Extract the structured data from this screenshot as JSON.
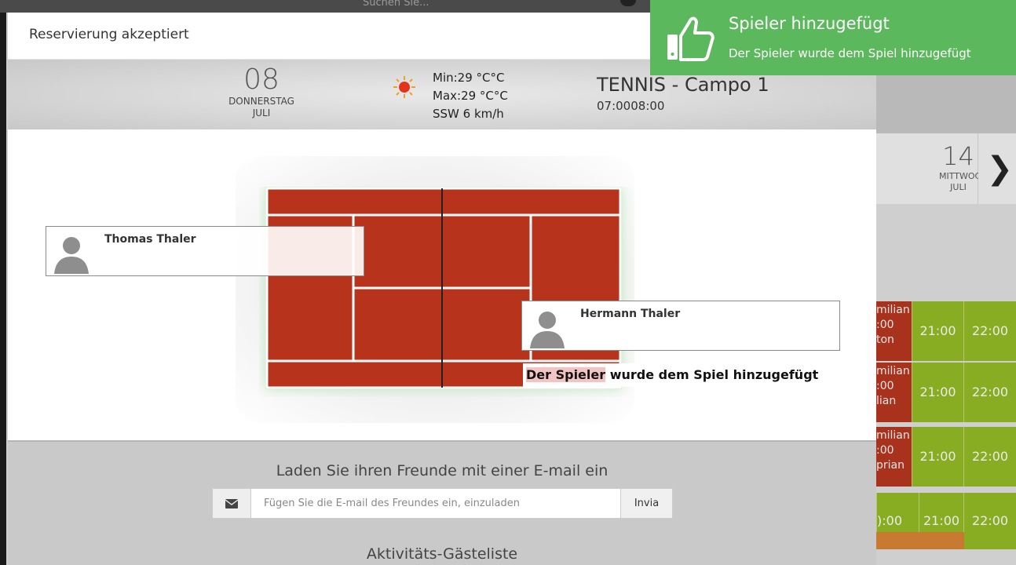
{
  "background": {
    "search_placeholder": "Suchen Sie...",
    "date_card": {
      "day": "14",
      "weekday": "MITTWOCH",
      "month": "JULI"
    },
    "rows": [
      {
        "name_top": "milian",
        "time_partial": ":00",
        "name_bottom": "ton",
        "times": [
          "21:00",
          "22:00"
        ]
      },
      {
        "name_top": "milian",
        "time_partial": ":00",
        "name_bottom": "lian",
        "times": [
          "21:00",
          "22:00"
        ]
      },
      {
        "name_top": "milian",
        "time_partial": ":00",
        "name_bottom": "prian",
        "times": [
          "21:00",
          "22:00"
        ]
      },
      {
        "name_top": "",
        "time_partial": "):00",
        "name_bottom": "",
        "times": [
          "21:00",
          "22:00"
        ]
      }
    ]
  },
  "modal": {
    "title": "Reservierung akzeptiert",
    "date": {
      "day": "08",
      "weekday": "DONNERSTAG",
      "month": "JULI"
    },
    "weather": {
      "min": "Min:29 °C°C",
      "max": "Max:29 °C°C",
      "wind": "SSW 6 km/h",
      "icon": "sun-icon"
    },
    "court": {
      "title": "TENNIS - Campo 1",
      "time": "07:0008:00"
    },
    "players": [
      {
        "name": "Thomas Thaler"
      },
      {
        "name": "Hermann Thaler"
      }
    ],
    "added_message": {
      "highlight": "Der Spieler",
      "rest": " wurde dem Spiel hinzugefügt"
    },
    "invite": {
      "title": "Laden Sie ihren Freunde mit einer E-mail ein",
      "placeholder": "Fügen Sie die E-mail des Freundes ein, einzuladen",
      "button": "Invia"
    },
    "guest_list_title": "Aktivitäts-Gästeliste"
  },
  "toast": {
    "title": "Spieler hinzugefügt",
    "message": "Der Spieler wurde dem Spiel hinzugefügt",
    "icon": "thumbs-up-icon",
    "color": "#5cb85c"
  },
  "colors": {
    "court": "#b8331c",
    "court_lines": "#ffffff",
    "slot_red": "#a8321c",
    "slot_green": "#88ac22"
  }
}
